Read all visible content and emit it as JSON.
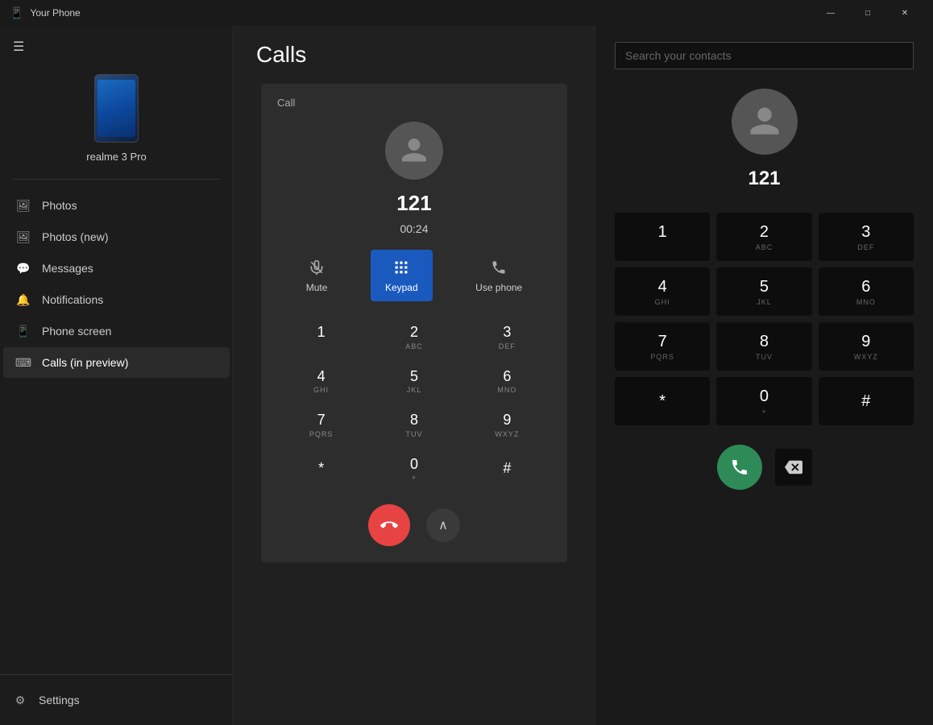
{
  "app": {
    "title": "Your Phone"
  },
  "titlebar": {
    "title": "Your Phone",
    "minimize_label": "—",
    "maximize_label": "□",
    "close_label": "✕"
  },
  "sidebar": {
    "hamburger": "☰",
    "device_name": "realme 3 Pro",
    "nav_items": [
      {
        "id": "photos",
        "label": "Photos",
        "icon": "🖼"
      },
      {
        "id": "photos-new",
        "label": "Photos (new)",
        "icon": "🖼"
      },
      {
        "id": "messages",
        "label": "Messages",
        "icon": "💬"
      },
      {
        "id": "notifications",
        "label": "Notifications",
        "icon": "🔔"
      },
      {
        "id": "phone-screen",
        "label": "Phone screen",
        "icon": "📱"
      },
      {
        "id": "calls",
        "label": "Calls (in preview)",
        "icon": "⌨"
      }
    ],
    "settings_label": "Settings",
    "settings_icon": "⚙"
  },
  "calls_page": {
    "title": "Calls",
    "phone_card": {
      "label": "Call",
      "caller_number": "121",
      "timer": "00:24",
      "controls": [
        {
          "id": "mute",
          "label": "Mute"
        },
        {
          "id": "keypad",
          "label": "Keypad",
          "active": true
        },
        {
          "id": "use-phone",
          "label": "Use phone"
        }
      ],
      "keypad": [
        {
          "digit": "1",
          "letters": ""
        },
        {
          "digit": "2",
          "letters": "ABC"
        },
        {
          "digit": "3",
          "letters": "DEF"
        },
        {
          "digit": "4",
          "letters": "GHI"
        },
        {
          "digit": "5",
          "letters": "JKL"
        },
        {
          "digit": "6",
          "letters": "MNO"
        },
        {
          "digit": "7",
          "letters": "PQRS"
        },
        {
          "digit": "8",
          "letters": "TUV"
        },
        {
          "digit": "9",
          "letters": "WXYZ"
        },
        {
          "digit": "*",
          "letters": ""
        },
        {
          "digit": "0",
          "letters": "+"
        },
        {
          "digit": "#",
          "letters": ""
        }
      ]
    }
  },
  "right_panel": {
    "search_placeholder": "Search your contacts",
    "caller_number": "121",
    "keypad": [
      {
        "digit": "1",
        "letters": ""
      },
      {
        "digit": "2",
        "letters": "ABC"
      },
      {
        "digit": "3",
        "letters": "DEF"
      },
      {
        "digit": "4",
        "letters": "GHI"
      },
      {
        "digit": "5",
        "letters": "JKL"
      },
      {
        "digit": "6",
        "letters": "MNO"
      },
      {
        "digit": "7",
        "letters": "PQRS"
      },
      {
        "digit": "8",
        "letters": "TUV"
      },
      {
        "digit": "9",
        "letters": "WXYZ"
      },
      {
        "digit": "*",
        "letters": ""
      },
      {
        "digit": "0",
        "letters": "+"
      },
      {
        "digit": "#",
        "letters": ""
      }
    ]
  }
}
